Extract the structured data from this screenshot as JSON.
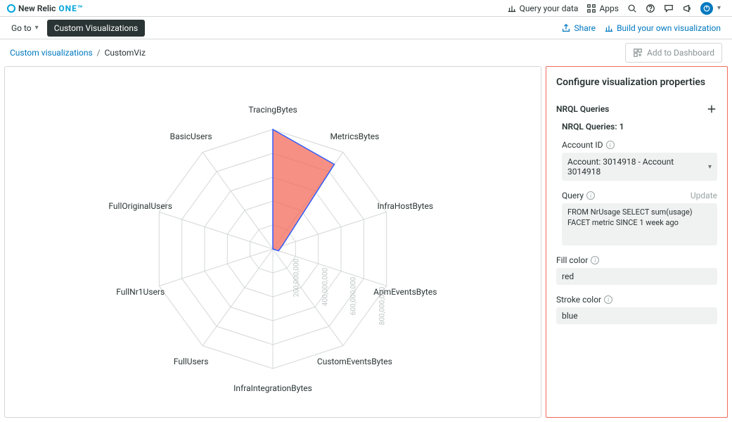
{
  "brand": {
    "name": "New Relic",
    "accent": "ONE™"
  },
  "topbar": {
    "query": "Query your data",
    "apps": "Apps"
  },
  "subbar": {
    "goto": "Go to",
    "pill": "Custom Visualizations",
    "share": "Share",
    "build": "Build your own visualization"
  },
  "breadcrumb": {
    "parent": "Custom visualizations",
    "current": "CustomViz"
  },
  "buttons": {
    "addDash": "Add to Dashboard"
  },
  "chart_data": {
    "type": "radar",
    "categories": [
      "TracingBytes",
      "MetricsBytes",
      "InfraHostBytes",
      "ApmEventsBytes",
      "CustomEventsBytes",
      "InfraIntegrationBytes",
      "FullUsers",
      "FullNr1Users",
      "FullOriginalUsers",
      "BasicUsers"
    ],
    "values": [
      800000000,
      700000000,
      65000000,
      40000000,
      0,
      0,
      0,
      0,
      0,
      0
    ],
    "series": [
      {
        "name": "sum(usage)",
        "values": [
          800000000,
          700000000,
          65000000,
          40000000,
          0,
          0,
          0,
          0,
          0,
          0
        ]
      }
    ],
    "fill_color": "red",
    "stroke_color": "blue",
    "radial_ticks": [
      200000000,
      400000000,
      600000000,
      800000000
    ],
    "radial_tick_labels": [
      "200,000,000",
      "400,000,000",
      "600,000,000",
      "800,000,000"
    ],
    "r_max": 800000000
  },
  "config": {
    "title": "Configure visualization properties",
    "nrql_section": "NRQL Queries",
    "nrql_count_prefix": "NRQL Queries:",
    "nrql_count_value": "1",
    "account_label": "Account ID",
    "account_value": "Account: 3014918 - Account 3014918",
    "query_label": "Query",
    "query_update": "Update",
    "query_value": "FROM NrUsage SELECT sum(usage) FACET metric SINCE 1 week ago",
    "fill_label": "Fill color",
    "fill_value": "red",
    "stroke_label": "Stroke color",
    "stroke_value": "blue"
  }
}
